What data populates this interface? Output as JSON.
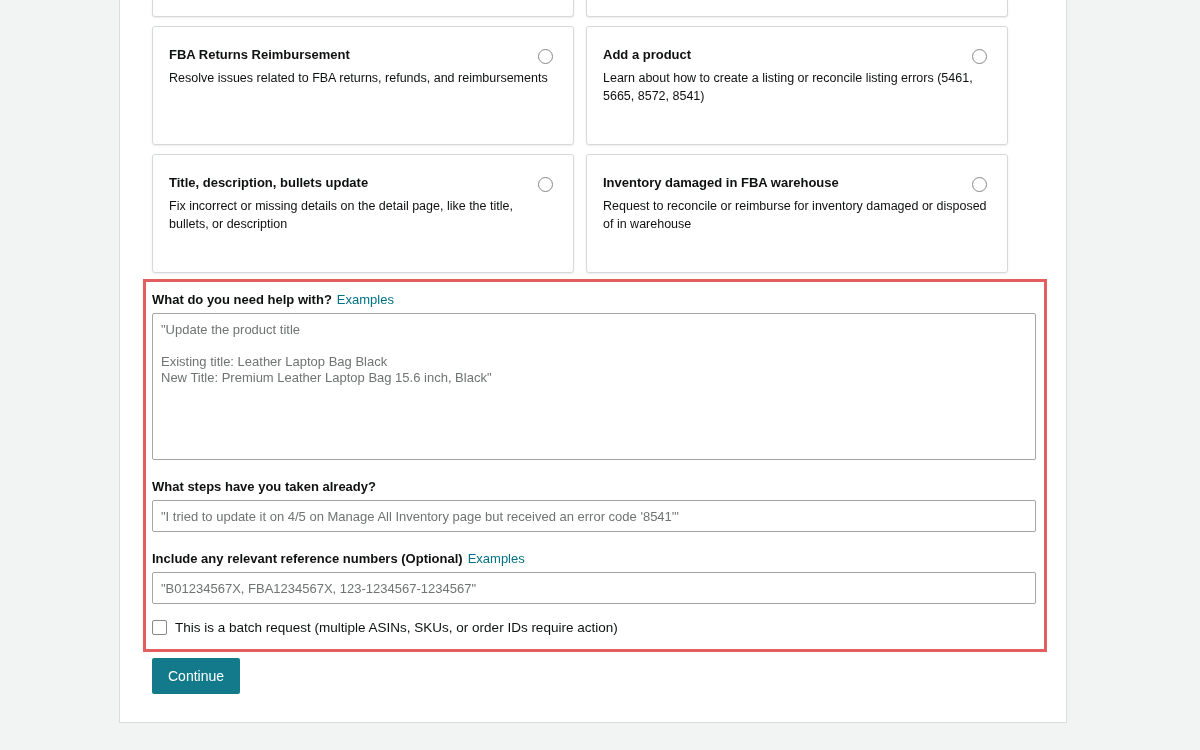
{
  "options": [
    {
      "title": "FBA Returns Reimbursement",
      "description": "Resolve issues related to FBA returns, refunds, and reimbursements",
      "selected": false
    },
    {
      "title": "Add a product",
      "description": "Learn about how to create a listing or reconcile listing errors (5461, 5665, 8572, 8541)",
      "selected": false
    },
    {
      "title": "Title, description, bullets update",
      "description": "Fix incorrect or missing details on the detail page, like the title, bullets, or description",
      "selected": false
    },
    {
      "title": "Inventory damaged in FBA warehouse",
      "description": "Request to reconcile or reimburse for inventory damaged or disposed of in warehouse",
      "selected": false
    }
  ],
  "help": {
    "label": "What do you need help with?",
    "link": "Examples",
    "placeholder": "\"Update the product title\n\nExisting title: Leather Laptop Bag Black\nNew Title: Premium Leather Laptop Bag 15.6 inch, Black\""
  },
  "steps": {
    "label": "What steps have you taken already?",
    "placeholder": "\"I tried to update it on 4/5 on Manage All Inventory page but received an error code '8541'\""
  },
  "references": {
    "label": "Include any relevant reference numbers (Optional)",
    "link": "Examples",
    "placeholder": "\"B01234567X, FBA1234567X, 123-1234567-1234567\""
  },
  "batch": {
    "label": "This is a batch request (multiple ASINs, SKUs, or order IDs require action)",
    "checked": false
  },
  "continue_button": "Continue"
}
